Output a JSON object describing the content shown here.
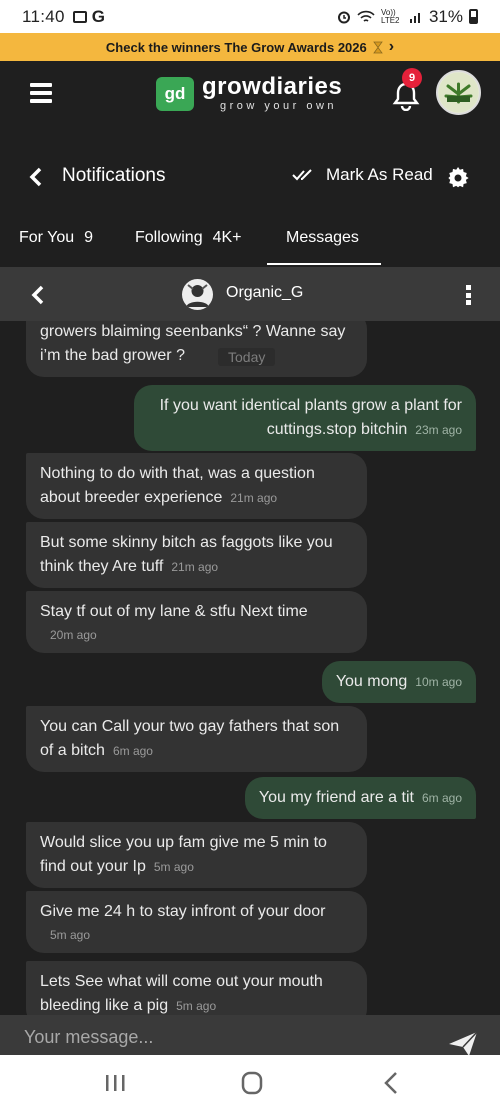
{
  "status": {
    "time": "11:40",
    "carrier": "Vo)) LTE2",
    "battery": "31%"
  },
  "banner": {
    "text": "Check the winners The Grow Awards 2026",
    "arrow": "›"
  },
  "header": {
    "logo_badge": "gd",
    "logo_title": "growdiaries",
    "logo_sub": "grow your own",
    "notification_count": "9",
    "icons": [
      "menu-icon",
      "bell-icon",
      "avatar"
    ]
  },
  "notifications": {
    "title": "Notifications",
    "mark_read": "Mark As Read"
  },
  "tabs": [
    {
      "label": "For You",
      "count": "9"
    },
    {
      "label": "Following",
      "count": "4K+"
    },
    {
      "label": "Messages",
      "count": ""
    }
  ],
  "conversation": {
    "name": "Organic_G"
  },
  "messages": [
    {
      "dir": "in",
      "text": "growers blaiming seenbanks“ ? Wanne say i’m the bad grower ?",
      "time": ""
    },
    {
      "dir": "out",
      "text": "If you want identical plants grow a plant for cuttings.stop bitchin",
      "time": "23m ago"
    },
    {
      "dir": "in",
      "text": "Nothing to do with that, was a question about breeder experience",
      "time": "21m ago"
    },
    {
      "dir": "in",
      "text": "But some skinny bitch as faggots like you think they Are tuff",
      "time": "21m ago"
    },
    {
      "dir": "in",
      "text": "Stay tf out of my lane & stfu Next time",
      "time": "20m ago"
    },
    {
      "dir": "out",
      "text": "You mong",
      "time": "10m ago"
    },
    {
      "dir": "in",
      "text": "You can Call your two gay fathers that son of a bitch",
      "time": "6m ago"
    },
    {
      "dir": "out",
      "text": "You my friend are a tit",
      "time": "6m ago"
    },
    {
      "dir": "in",
      "text": "Would slice you up fam give me 5 min to find out your Ip",
      "time": "5m ago"
    },
    {
      "dir": "in",
      "text": "Give me 24 h to stay infront of your door",
      "time": "5m ago"
    },
    {
      "dir": "in",
      "text": "Lets See what will come out your mouth bleeding like a pig",
      "time": "5m ago"
    }
  ],
  "today_label": "Today",
  "composer": {
    "placeholder": "Your message..."
  },
  "colors": {
    "background": "#1f1f1f",
    "banner": "#f4b73e",
    "incoming_bubble": "#333333",
    "outgoing_bubble": "#2f4a37",
    "badge": "#e5213a",
    "brand_green": "#3aa755"
  }
}
